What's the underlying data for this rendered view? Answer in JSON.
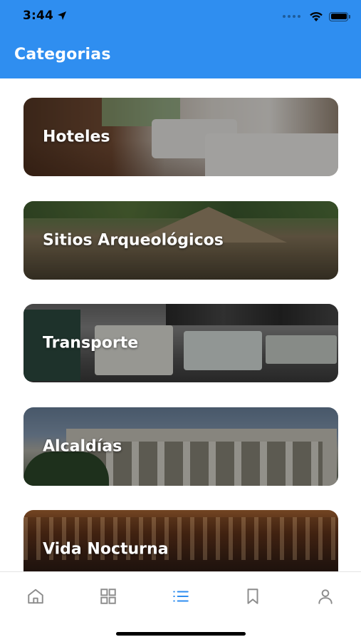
{
  "status_bar": {
    "time": "3:44"
  },
  "header": {
    "title": "Categorias"
  },
  "categories": [
    {
      "label": "Hoteles",
      "image": "hotel-room-photo"
    },
    {
      "label": "Sitios Arqueológicos",
      "image": "archaeological-site-photo"
    },
    {
      "label": "Transporte",
      "image": "bus-terminal-photo"
    },
    {
      "label": "Alcaldías",
      "image": "city-hall-photo"
    },
    {
      "label": "Vida Nocturna",
      "image": "nightlife-bar-photo"
    }
  ],
  "tabbar": {
    "items": [
      {
        "icon": "home-icon",
        "active": false
      },
      {
        "icon": "grid-icon",
        "active": false
      },
      {
        "icon": "list-icon",
        "active": true
      },
      {
        "icon": "bookmark-icon",
        "active": false
      },
      {
        "icon": "user-icon",
        "active": false
      }
    ]
  },
  "colors": {
    "accent": "#2f8ef0",
    "tab_inactive": "#8c8c8c"
  }
}
